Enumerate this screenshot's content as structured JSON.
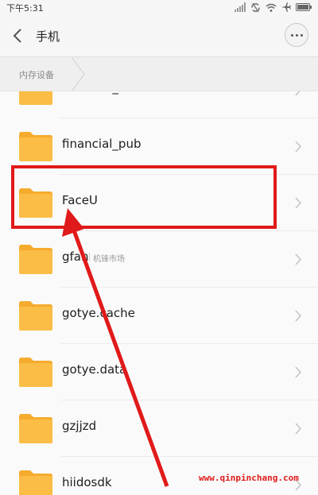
{
  "status_bar": {
    "time": "下午5:31",
    "icons": [
      "signal-icon",
      "sync-icon",
      "wifi-icon",
      "airplane-icon",
      "battery-icon"
    ]
  },
  "header": {
    "title": "手机",
    "back_icon": "chevron-left-icon",
    "more_icon": "more-dots-icon"
  },
  "breadcrumb": {
    "items": [
      "内存设备"
    ]
  },
  "folders": [
    {
      "name": "financial_client",
      "tag": ""
    },
    {
      "name": "financial_pub",
      "tag": ""
    },
    {
      "name": "FaceU",
      "tag": ""
    },
    {
      "name": "gfan",
      "tag": "机锋市场"
    },
    {
      "name": "gotye.cache",
      "tag": ""
    },
    {
      "name": "gotye.data",
      "tag": ""
    },
    {
      "name": "gzjjzd",
      "tag": ""
    },
    {
      "name": "hiidosdk",
      "tag": ""
    }
  ],
  "annotation": {
    "highlight_color": "#e01a1a",
    "highlighted_item": "FaceU"
  },
  "colors": {
    "folder": "#fbbd45",
    "folder_tab": "#f5ab2e",
    "accent_red": "#e01a1a"
  },
  "watermark": "www.qinpinchang.com"
}
